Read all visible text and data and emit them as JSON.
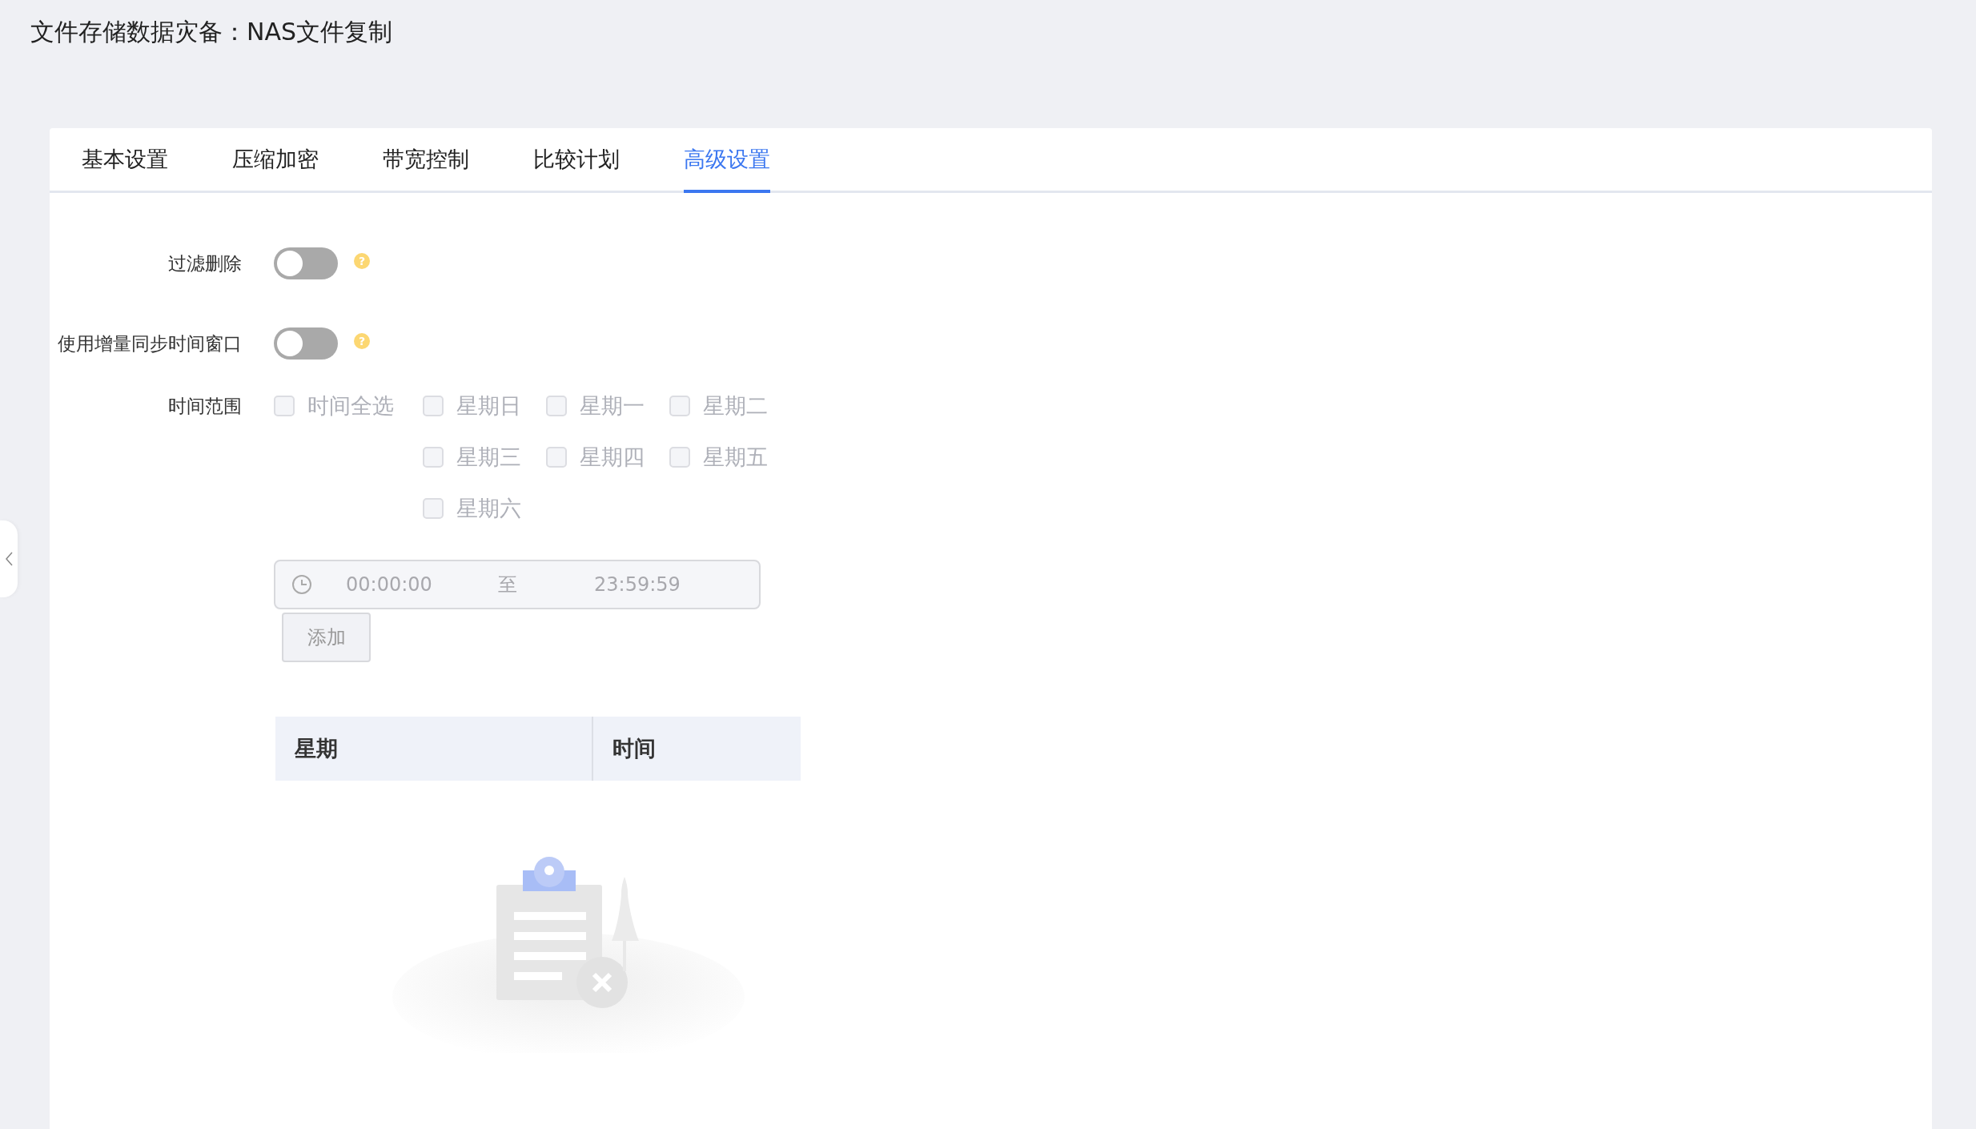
{
  "page_title": "文件存储数据灾备：NAS文件复制",
  "tabs": [
    {
      "label": "基本设置",
      "selected": false
    },
    {
      "label": "压缩加密",
      "selected": false
    },
    {
      "label": "带宽控制",
      "selected": false
    },
    {
      "label": "比较计划",
      "selected": false
    },
    {
      "label": "高级设置",
      "selected": true
    }
  ],
  "switches": [
    {
      "label": "过滤删除",
      "on": false,
      "help": "?"
    },
    {
      "label": "使用增量同步时间窗口",
      "on": false,
      "help": "?"
    }
  ],
  "time_range": {
    "label": "时间范围",
    "disabled": true,
    "select_all": {
      "label": "时间全选",
      "checked": false
    },
    "days": [
      {
        "label": "星期日",
        "checked": false
      },
      {
        "label": "星期一",
        "checked": false
      },
      {
        "label": "星期二",
        "checked": false
      },
      {
        "label": "星期三",
        "checked": false
      },
      {
        "label": "星期四",
        "checked": false
      },
      {
        "label": "星期五",
        "checked": false
      },
      {
        "label": "星期六",
        "checked": false
      }
    ],
    "start": "00:00:00",
    "separator": "至",
    "end": "23:59:59",
    "add_button": "添加"
  },
  "table": {
    "columns": [
      "星期",
      "时间"
    ]
  }
}
